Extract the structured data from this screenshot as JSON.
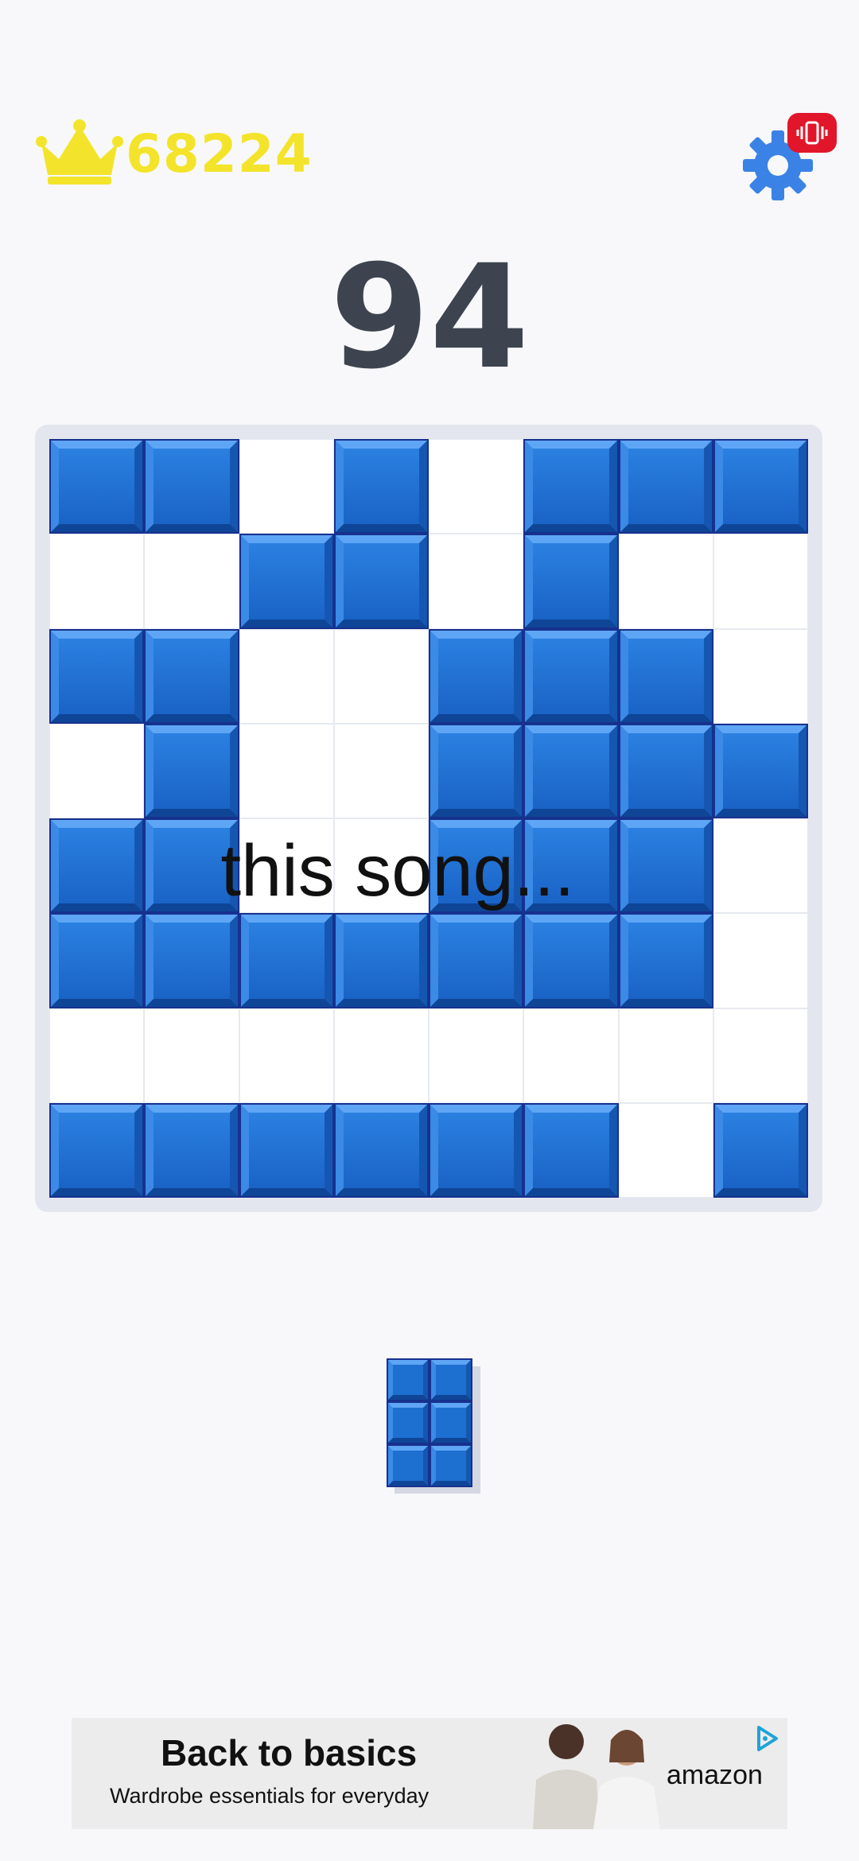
{
  "colors": {
    "background": "#f8f8fa",
    "best_score": "#f3e42b",
    "current_score": "#3d4450",
    "block_blue": "#1d6fd0",
    "settings_blue": "#3b82e6",
    "vibrate_badge": "#e2162b"
  },
  "header": {
    "crown_icon": "crown-icon",
    "best_score": "68224",
    "settings_icon": "gear-icon",
    "vibration_icon": "vibration-icon"
  },
  "score": {
    "current": "94"
  },
  "board": {
    "rows": 8,
    "cols": 8,
    "cells": [
      [
        1,
        1,
        0,
        1,
        0,
        1,
        1,
        1
      ],
      [
        0,
        0,
        1,
        1,
        0,
        1,
        0,
        0
      ],
      [
        1,
        1,
        0,
        0,
        1,
        1,
        1,
        0
      ],
      [
        0,
        1,
        0,
        0,
        1,
        1,
        1,
        1
      ],
      [
        1,
        1,
        0,
        0,
        1,
        1,
        1,
        0
      ],
      [
        1,
        1,
        1,
        1,
        1,
        1,
        1,
        0
      ],
      [
        0,
        0,
        0,
        0,
        0,
        0,
        0,
        0
      ],
      [
        1,
        1,
        1,
        1,
        1,
        1,
        0,
        1
      ]
    ]
  },
  "overlay": {
    "caption": "this song..."
  },
  "next_piece": {
    "rows": 3,
    "cols": 2
  },
  "ad": {
    "title": "Back to basics",
    "subtitle": "Wardrobe essentials for everyday",
    "brand": "amazon",
    "choices_icon": "ad-choices-icon"
  }
}
